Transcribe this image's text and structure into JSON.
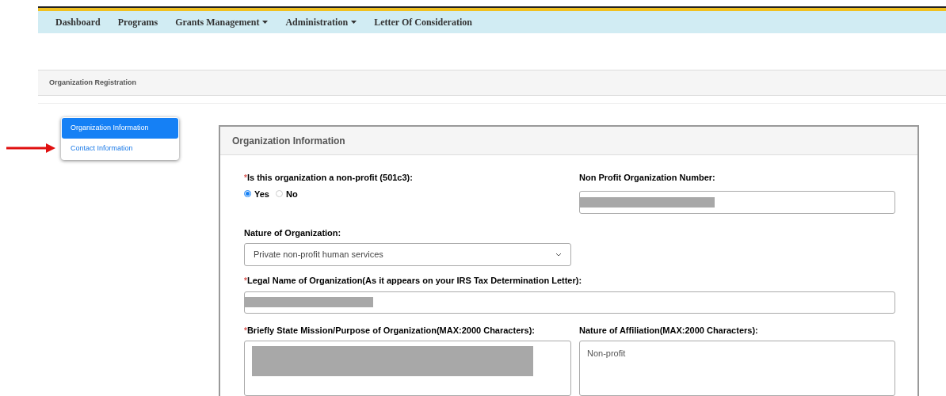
{
  "nav": {
    "items": [
      {
        "label": "Dashboard",
        "dropdown": false
      },
      {
        "label": "Programs",
        "dropdown": false
      },
      {
        "label": "Grants Management",
        "dropdown": true
      },
      {
        "label": "Administration",
        "dropdown": true
      },
      {
        "label": "Letter Of Consideration",
        "dropdown": false
      }
    ]
  },
  "breadcrumb": "Organization Registration",
  "sidebar": {
    "items": [
      {
        "label": "Organization Information",
        "selected": true
      },
      {
        "label": "Contact Information",
        "selected": false
      }
    ]
  },
  "panel": {
    "title": "Organization Information",
    "nonprofit": {
      "label": "Is this organization a non-profit (501c3):",
      "required_mark": "*",
      "options": [
        {
          "label": "Yes",
          "selected": true
        },
        {
          "label": "No",
          "selected": false
        }
      ]
    },
    "number": {
      "label": "Non Profit Organization Number:"
    },
    "nature": {
      "label": "Nature of Organization:",
      "value": "Private non-profit human services"
    },
    "legal_name": {
      "label": "Legal Name of Organization(As it appears on your IRS Tax Determination Letter):",
      "required_mark": "*"
    },
    "mission": {
      "label": "Briefly State Mission/Purpose of Organization(MAX:2000 Characters):",
      "required_mark": "*"
    },
    "affiliation": {
      "label": "Nature of Affiliation(MAX:2000 Characters):",
      "value": "Non-profit"
    }
  }
}
